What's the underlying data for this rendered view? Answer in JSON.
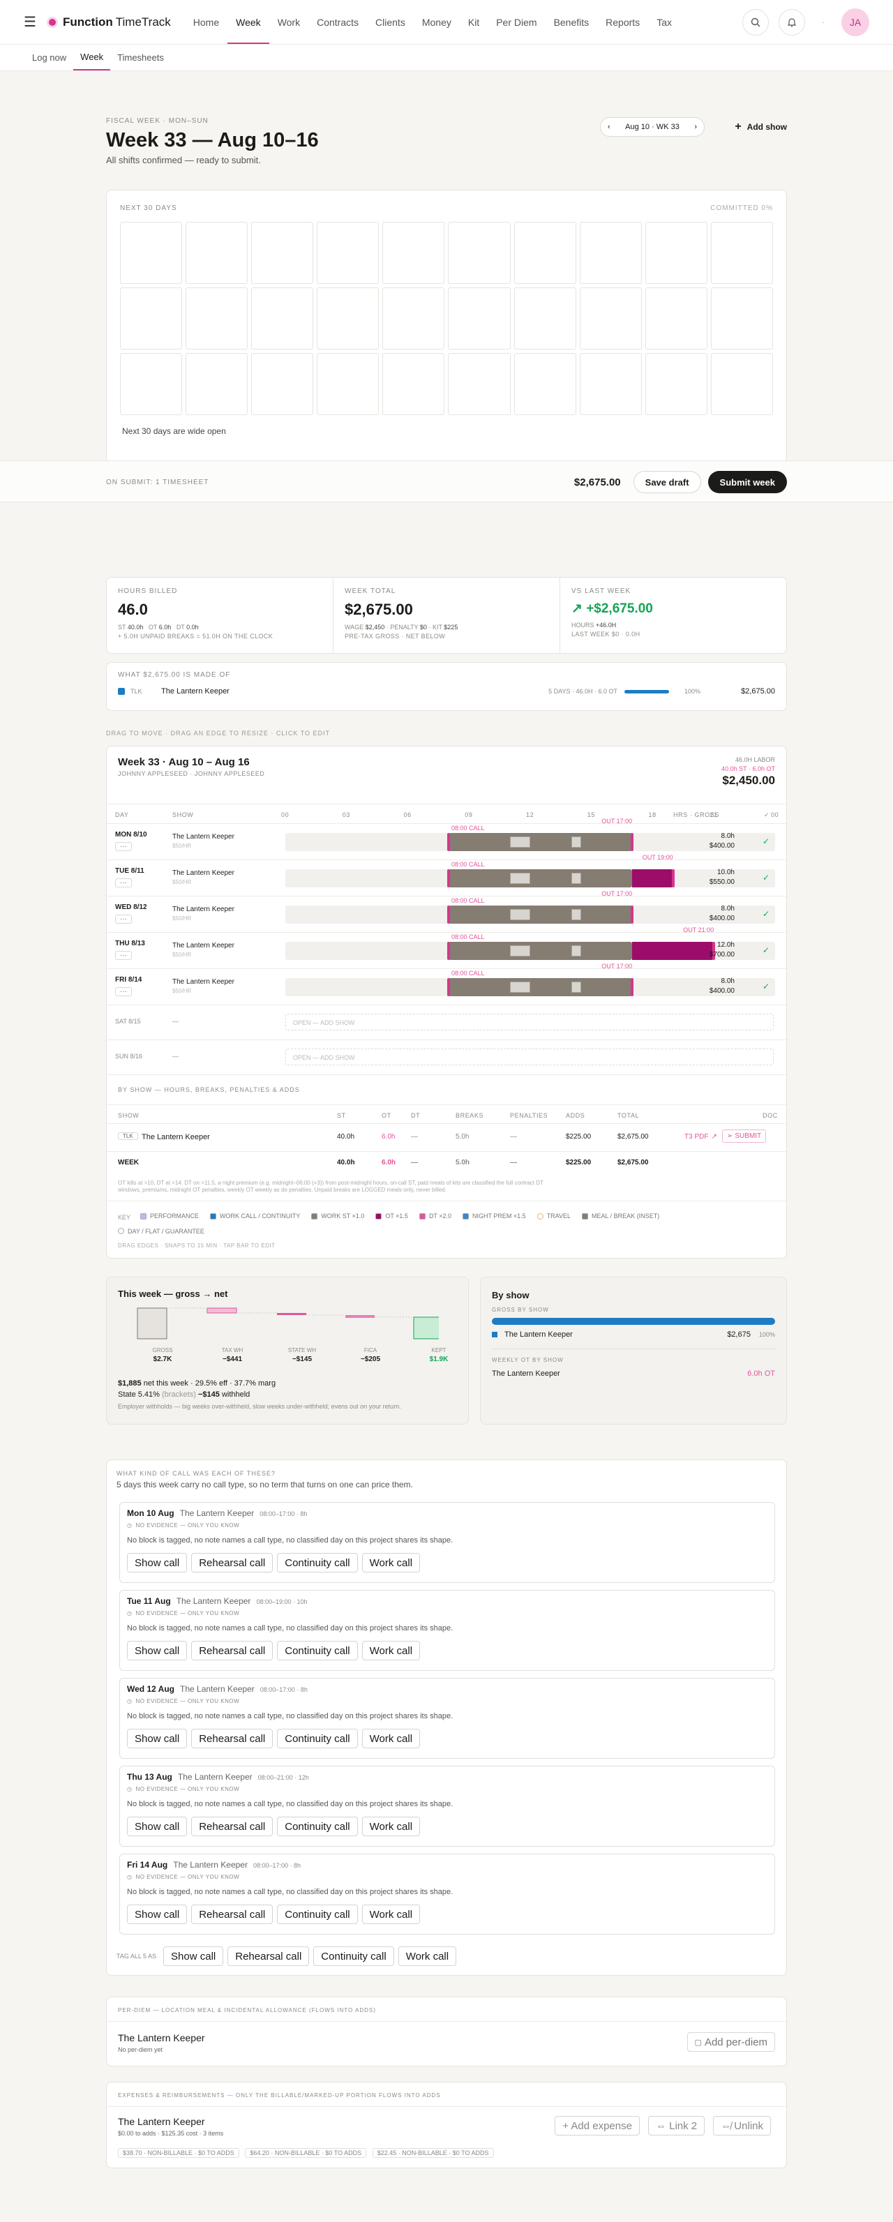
{
  "app": {
    "brand_bold": "Function",
    "brand_light": "TimeTrack",
    "avatar": "JA"
  },
  "nav": [
    "Home",
    "Week",
    "Work",
    "Contracts",
    "Clients",
    "Money",
    "Kit",
    "Per Diem",
    "Benefits",
    "Reports",
    "Tax"
  ],
  "subnav": [
    "Log now",
    "Week",
    "Timesheets"
  ],
  "header": {
    "eyebrow": "FISCAL WEEK · MON–SUN",
    "title": "Week 33 — Aug 10–16",
    "subtitle": "All shifts confirmed — ready to submit.",
    "week_pill": "Aug 10 · WK 33",
    "add_show": "Add show"
  },
  "next30": {
    "title": "NEXT 30 DAYS",
    "committed": "COMMITTED 0%",
    "empty": "Next 30 days are wide open"
  },
  "submitbar": {
    "note": "ON SUBMIT: 1 TIMESHEET",
    "total": "$2,675.00",
    "save": "Save draft",
    "submit": "Submit week"
  },
  "kpi": {
    "hours_label": "HOURS BILLED",
    "hours": "46.0",
    "st_l": "ST",
    "st": "40.0h",
    "ot_l": "OT",
    "ot": "6.0h",
    "dt_l": "DT",
    "dt": "0.0h",
    "hours_note": "+ 5.0H UNPAID BREAKS = 51.0H ON THE CLOCK",
    "total_label": "WEEK TOTAL",
    "total": "$2,675.00",
    "wage_l": "WAGE",
    "wage": "$2,450",
    "pen_l": "PENALTY",
    "pen": "$0",
    "kit_l": "KIT",
    "kit": "$225",
    "total_note": "PRE-TAX GROSS · NET BELOW",
    "vs_label": "VS LAST WEEK",
    "vs": "+$2,675.00",
    "vs_hours_l": "HOURS",
    "vs_hours": "+46.0H",
    "vs_note": "LAST WEEK $0 · 0.0H"
  },
  "madeof": {
    "title": "WHAT $2,675.00 IS MADE OF",
    "tag": "TLK",
    "show": "The Lantern Keeper",
    "meta": "5 DAYS · 46.0H · 6.0 OT",
    "pct": "100%",
    "amount": "$2,675.00"
  },
  "drag_hint": "DRAG TO MOVE · DRAG AN EDGE TO RESIZE · CLICK TO EDIT",
  "timesheet": {
    "title": "Week 33 · Aug 10 – Aug 16",
    "sub": "JOHNNY APPLESEED · JOHNNY APPLESEED",
    "labor_l": "46.0H LABOR",
    "labor_sub": "40.0h ST · 6.0h OT",
    "labor": "$2,450.00",
    "col_day": "DAY",
    "col_show": "SHOW",
    "col_hrs": "HRS · GROSS",
    "ticks": [
      "00",
      "03",
      "06",
      "09",
      "12",
      "15",
      "18",
      "21",
      "00"
    ],
    "days": [
      {
        "day": "MON 8/10",
        "show": "The Lantern Keeper",
        "rate": "$50/HR",
        "call": "08:00 CALL",
        "out": "OUT 17:00",
        "start": 8,
        "end": 17,
        "ot": 0,
        "hrs": "8.0h",
        "gross": "$400.00"
      },
      {
        "day": "TUE 8/11",
        "show": "The Lantern Keeper",
        "rate": "$50/HR",
        "call": "08:00 CALL",
        "out": "OUT 19:00",
        "start": 8,
        "end": 19,
        "ot": 2,
        "hrs": "10.0h",
        "gross": "$550.00"
      },
      {
        "day": "WED 8/12",
        "show": "The Lantern Keeper",
        "rate": "$50/HR",
        "call": "08:00 CALL",
        "out": "OUT 17:00",
        "start": 8,
        "end": 17,
        "ot": 0,
        "hrs": "8.0h",
        "gross": "$400.00"
      },
      {
        "day": "THU 8/13",
        "show": "The Lantern Keeper",
        "rate": "$50/HR",
        "call": "08:00 CALL",
        "out": "OUT 21:00",
        "start": 8,
        "end": 21,
        "ot": 4,
        "hrs": "12.0h",
        "gross": "$700.00"
      },
      {
        "day": "FRI 8/14",
        "show": "The Lantern Keeper",
        "rate": "$50/HR",
        "call": "08:00 CALL",
        "out": "OUT 17:00",
        "start": 8,
        "end": 17,
        "ot": 0,
        "hrs": "8.0h",
        "gross": "$400.00"
      }
    ],
    "empty_days": [
      {
        "day": "SAT 8/15",
        "dash": "—",
        "open": "OPEN — ADD SHOW"
      },
      {
        "day": "SUN 8/16",
        "dash": "—",
        "open": "OPEN — ADD SHOW"
      }
    ],
    "byshow_title": "BY SHOW — HOURS, BREAKS, PENALTIES & ADDS",
    "byshow_cols": [
      "SHOW",
      "ST",
      "OT",
      "DT",
      "BREAKS",
      "PENALTIES",
      "ADDS",
      "TOTAL",
      "DOC"
    ],
    "byshow_row": {
      "tag": "TLK",
      "show": "The Lantern Keeper",
      "st": "40.0h",
      "ot": "6.0h",
      "dt": "—",
      "breaks": "5.0h",
      "pen": "—",
      "adds": "$225.00",
      "total": "$2,675.00",
      "pdf": "T3 PDF",
      "submit": "SUBMIT"
    },
    "week_row": {
      "label": "WEEK",
      "st": "40.0h",
      "ot": "6.0h",
      "dt": "—",
      "breaks": "5.0h",
      "pen": "—",
      "adds": "$225.00",
      "total": "$2,675.00"
    },
    "footnote1": "OT kills at >10, DT at >14. DT on >11.5, a night premium (e.g. midnight–06:00 (+3)) from post-midnight hours, on-call ST, paid meals of kits are classified the full contract DT",
    "footnote2": "windows, premiums, midnight OT penalties, weekly OT weekly as do penalties. Unpaid breaks are LOGGED meals only, never billed.",
    "legend_key": "KEY",
    "legend": [
      "PERFORMANCE",
      "WORK CALL / CONTINUITY",
      "WORK ST ×1.0",
      "OT ×1.5",
      "DT ×2.0",
      "NIGHT PREM ×1.5",
      "TRAVEL",
      "MEAL / BREAK (INSET)",
      "DAY / FLAT / GUARANTEE"
    ],
    "snap": "DRAG EDGES · SNAPS TO 15 MIN · TAP BAR TO EDIT"
  },
  "gross": {
    "title": "This week — gross → net",
    "labels": [
      "GROSS",
      "TAX WH",
      "STATE WH",
      "FICA",
      "KEPT"
    ],
    "values": [
      "$2.7K",
      "−$441",
      "−$145",
      "−$205",
      "$1.9K"
    ],
    "net": "$1,885",
    "net_t": "net this week ·",
    "eff": "29.5% eff ·",
    "marg": "37.7% marg",
    "state_pre": "State 5.41%",
    "state_b": "(brackets)",
    "state_w": "−$145",
    "state_t": "withheld",
    "note": "Employer withholds — big weeks over-withheld, slow weeks under-withheld; evens out on your return."
  },
  "byshow": {
    "title": "By show",
    "gross_l": "GROSS BY SHOW",
    "show": "The Lantern Keeper",
    "amount": "$2,675",
    "pct": "100%",
    "ot_l": "WEEKLY OT BY SHOW",
    "ot_show": "The Lantern Keeper",
    "ot": "6.0h OT"
  },
  "calls": {
    "eyebrow": "WHAT KIND OF CALL WAS EACH OF THESE?",
    "sub": "5 days this week carry no call type, so no term that turns on one can price them.",
    "evidence": "NO EVIDENCE — ONLY YOU KNOW",
    "reason": "No block is tagged, no note names a call type, no classified day on this project shares its shape.",
    "buttons": [
      "Show call",
      "Rehearsal call",
      "Continuity call",
      "Work call"
    ],
    "days": [
      {
        "d": "Mon 10 Aug",
        "show": "The Lantern Keeper",
        "t": "08:00–17:00 · 8h"
      },
      {
        "d": "Tue 11 Aug",
        "show": "The Lantern Keeper",
        "t": "08:00–19:00 · 10h"
      },
      {
        "d": "Wed 12 Aug",
        "show": "The Lantern Keeper",
        "t": "08:00–17:00 · 8h"
      },
      {
        "d": "Thu 13 Aug",
        "show": "The Lantern Keeper",
        "t": "08:00–21:00 · 12h"
      },
      {
        "d": "Fri 14 Aug",
        "show": "The Lantern Keeper",
        "t": "08:00–17:00 · 8h"
      }
    ],
    "tagall": "TAG ALL 5 AS"
  },
  "perdiem": {
    "eyebrow": "PER-DIEM — LOCATION MEAL & INCIDENTAL ALLOWANCE (FLOWS INTO ADDS)",
    "show": "The Lantern Keeper",
    "none": "No per-diem yet",
    "add": "Add per-diem"
  },
  "expense": {
    "eyebrow": "EXPENSES & REIMBURSEMENTS — ONLY THE BILLABLE/MARKED-UP PORTION FLOWS INTO ADDS",
    "show": "The Lantern Keeper",
    "sub": "$0.00 to adds · $125.35 cost · 3 items",
    "add": "+ Add expense",
    "link": "⇔ Link 2",
    "unlink": "⇎ Unlink",
    "chips": [
      "$38.70 · NON-BILLABLE · $0 TO ADDS",
      "$64.20 · NON-BILLABLE · $0 TO ADDS",
      "$22.45 · NON-BILLABLE · $0 TO ADDS"
    ]
  },
  "colors": {
    "accent": "#d6358e",
    "st": "#857c72",
    "ot": "#9c0d6a",
    "blue": "#1d7cc3",
    "green": "#14a455"
  }
}
